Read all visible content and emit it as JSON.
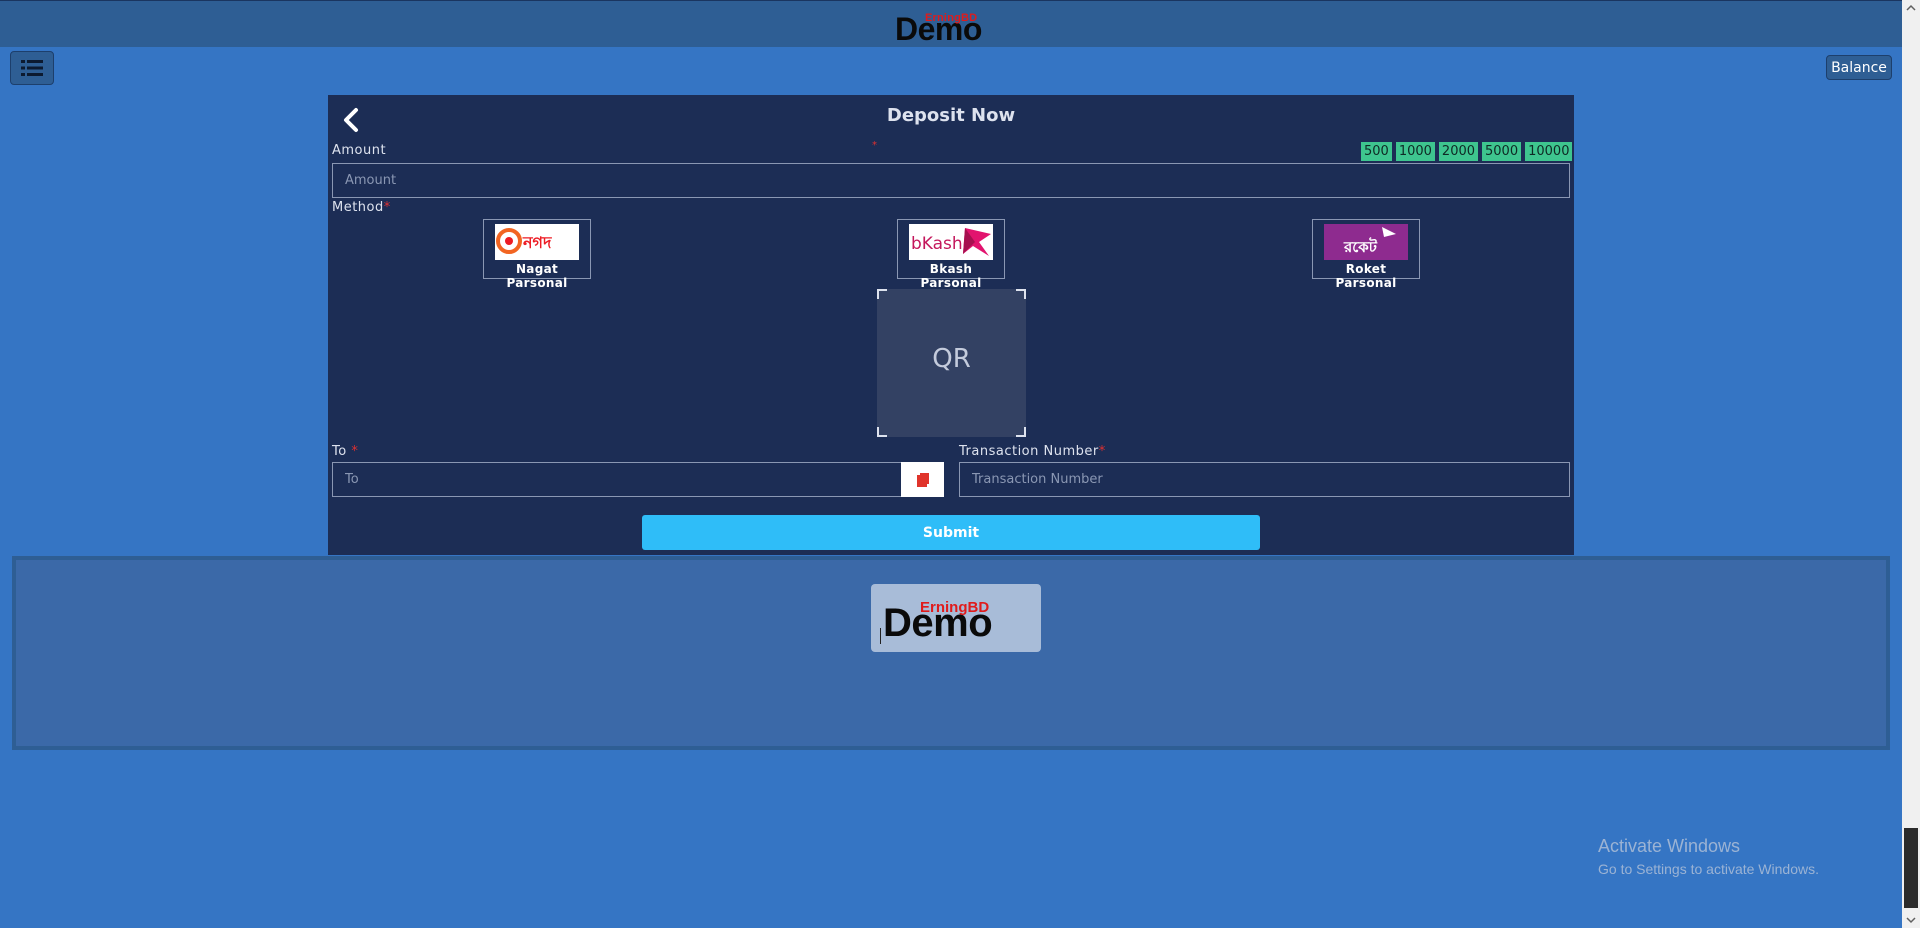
{
  "header": {
    "logo_small": "ErningBD",
    "logo_big": "Demo",
    "balance_label": "Balance"
  },
  "icons": {
    "menu": "list-icon",
    "back": "chevron-left-icon",
    "copy": "copy-icon"
  },
  "deposit": {
    "title": "Deposit Now",
    "amount_label": "Amount",
    "required_mark": "*",
    "amount_placeholder": "Amount",
    "quick_amounts": [
      "500",
      "1000",
      "2000",
      "5000",
      "10000"
    ],
    "method_label": "Method",
    "methods": [
      {
        "name": "Nagat Parsonal",
        "logo_text": "নগদ"
      },
      {
        "name": "Bkash Parsonal",
        "logo_text": "bKash"
      },
      {
        "name": "Roket Parsonal",
        "logo_text": "রকেট"
      }
    ],
    "qr_text": "QR",
    "to_label": "To",
    "to_placeholder": "To",
    "txn_label": "Transaction Number",
    "txn_placeholder": "Transaction Number",
    "submit_label": "Submit"
  },
  "footer": {
    "logo_small": "ErningBD",
    "logo_big": "Demo"
  },
  "watermark": {
    "title": "Activate Windows",
    "subtitle": "Go to Settings to activate Windows."
  },
  "colors": {
    "background": "#3575c4",
    "panel": "#1c2d55",
    "quick_amount": "#3ec58f",
    "submit": "#2fbdf8",
    "required": "#e03030"
  }
}
